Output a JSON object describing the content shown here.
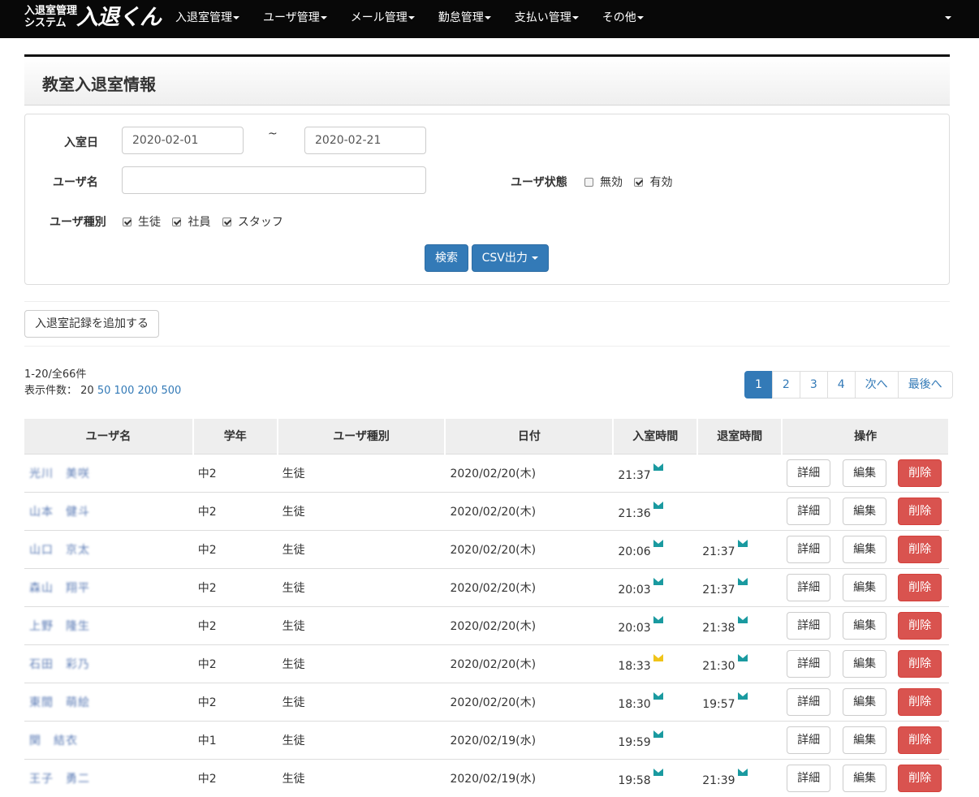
{
  "app": {
    "logo_small": "入退室管理\nシステム",
    "logo_big": "入退くん",
    "colors": {
      "navbar": "#080808",
      "primary": "#337ab7",
      "danger": "#d9534f",
      "mail_icon": "#1a9aa0",
      "mail_icon_alert": "#f0c419"
    }
  },
  "nav": [
    {
      "label": "入退室管理"
    },
    {
      "label": "ユーザ管理"
    },
    {
      "label": "メール管理"
    },
    {
      "label": "勤怠管理"
    },
    {
      "label": "支払い管理"
    },
    {
      "label": "その他"
    }
  ],
  "page": {
    "title": "教室入退室情報"
  },
  "search": {
    "date_label": "入室日",
    "date_from": "2020-02-01",
    "date_sep": "~",
    "date_to": "2020-02-21",
    "username_label": "ユーザ名",
    "username_value": "",
    "status_label": "ユーザ状態",
    "status_options": [
      {
        "label": "無効",
        "checked": false
      },
      {
        "label": "有効",
        "checked": true
      }
    ],
    "type_label": "ユーザ種別",
    "type_options": [
      {
        "label": "生徒",
        "checked": true
      },
      {
        "label": "社員",
        "checked": true
      },
      {
        "label": "スタッフ",
        "checked": true
      }
    ],
    "search_button": "検索",
    "csv_button": "CSV出力"
  },
  "add_button": "入退室記録を追加する",
  "summary": {
    "range": "1-20/全66件",
    "perpage_label": "表示件数：",
    "perpage_current": "20",
    "perpage_options": [
      "50",
      "100",
      "200",
      "500"
    ]
  },
  "pagination": {
    "pages": [
      "1",
      "2",
      "3",
      "4"
    ],
    "active": "1",
    "next": "次へ",
    "last": "最後へ"
  },
  "table": {
    "columns": [
      "ユーザ名",
      "学年",
      "ユーザ種別",
      "日付",
      "入室時間",
      "退室時間",
      "操作"
    ],
    "detail_label": "詳細",
    "edit_label": "編集",
    "delete_label": "削除",
    "rows": [
      {
        "name": "光川　美咲",
        "grade": "中2",
        "type": "生徒",
        "date": "2020/02/20(木)",
        "in": "21:37",
        "in_mail": "mail-icon",
        "out": "",
        "out_mail": ""
      },
      {
        "name": "山本　健斗",
        "grade": "中2",
        "type": "生徒",
        "date": "2020/02/20(木)",
        "in": "21:36",
        "in_mail": "mail-icon",
        "out": "",
        "out_mail": ""
      },
      {
        "name": "山口　京太",
        "grade": "中2",
        "type": "生徒",
        "date": "2020/02/20(木)",
        "in": "20:06",
        "in_mail": "mail-icon",
        "out": "21:37",
        "out_mail": "mail-icon"
      },
      {
        "name": "森山　翔平",
        "grade": "中2",
        "type": "生徒",
        "date": "2020/02/20(木)",
        "in": "20:03",
        "in_mail": "mail-icon",
        "out": "21:37",
        "out_mail": "mail-icon"
      },
      {
        "name": "上野　隆生",
        "grade": "中2",
        "type": "生徒",
        "date": "2020/02/20(木)",
        "in": "20:03",
        "in_mail": "mail-icon",
        "out": "21:38",
        "out_mail": "mail-icon"
      },
      {
        "name": "石田　彩乃",
        "grade": "中2",
        "type": "生徒",
        "date": "2020/02/20(木)",
        "in": "18:33",
        "in_mail": "mail-alert-icon",
        "out": "21:30",
        "out_mail": "mail-icon"
      },
      {
        "name": "東間　萌絵",
        "grade": "中2",
        "type": "生徒",
        "date": "2020/02/20(木)",
        "in": "18:30",
        "in_mail": "mail-icon",
        "out": "19:57",
        "out_mail": "mail-icon"
      },
      {
        "name": "関　結衣",
        "grade": "中1",
        "type": "生徒",
        "date": "2020/02/19(水)",
        "in": "19:59",
        "in_mail": "mail-icon",
        "out": "",
        "out_mail": ""
      },
      {
        "name": "王子　勇二",
        "grade": "中2",
        "type": "生徒",
        "date": "2020/02/19(水)",
        "in": "19:58",
        "in_mail": "mail-icon",
        "out": "21:39",
        "out_mail": "mail-icon"
      }
    ]
  }
}
